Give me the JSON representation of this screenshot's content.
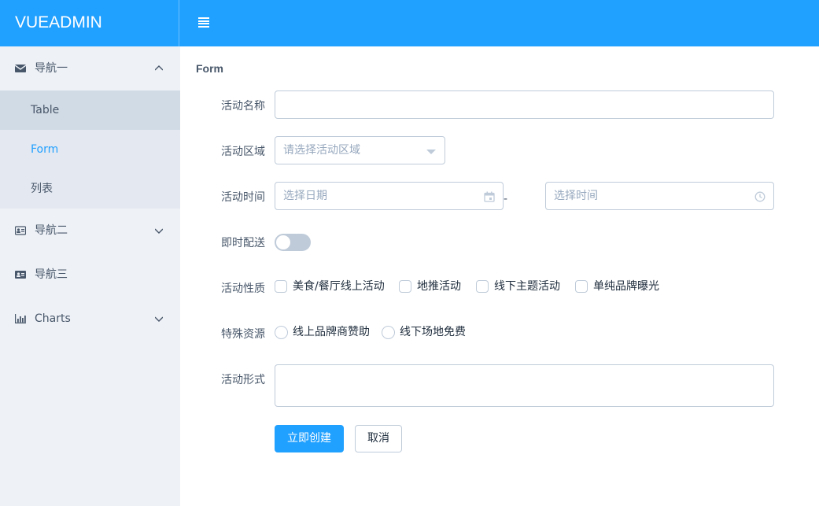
{
  "header": {
    "logo": "VUEADMIN",
    "menu_icon": "hamburger-icon",
    "color": "#20a0ff"
  },
  "sidebar": {
    "groups": [
      {
        "label": "导航一",
        "icon": "envelope-icon",
        "expanded": true,
        "children": [
          {
            "label": "Table"
          },
          {
            "label": "Form",
            "active": true
          },
          {
            "label": "列表"
          }
        ]
      },
      {
        "label": "导航二",
        "icon": "id-card-icon",
        "expanded": false
      },
      {
        "label": "导航三",
        "icon": "id-card-icon",
        "expanded": false
      },
      {
        "label": "Charts",
        "icon": "bar-chart-icon",
        "expanded": false
      }
    ]
  },
  "main": {
    "title": "Form",
    "form": {
      "name": {
        "label": "活动名称",
        "value": ""
      },
      "region": {
        "label": "活动区域",
        "placeholder": "请选择活动区域"
      },
      "time": {
        "label": "活动时间",
        "date_placeholder": "选择日期",
        "separator": "-",
        "time_placeholder": "选择时间"
      },
      "delivery": {
        "label": "即时配送",
        "on": false
      },
      "type": {
        "label": "活动性质",
        "options": [
          "美食/餐厅线上活动",
          "地推活动",
          "线下主题活动",
          "单纯品牌曝光"
        ]
      },
      "resource": {
        "label": "特殊资源",
        "options": [
          "线上品牌商赞助",
          "线下场地免费"
        ]
      },
      "desc": {
        "label": "活动形式",
        "value": ""
      },
      "submit_label": "立即创建",
      "cancel_label": "取消"
    }
  }
}
